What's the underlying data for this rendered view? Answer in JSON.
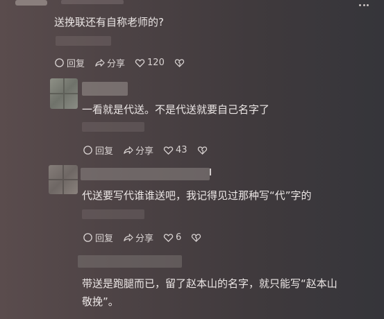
{
  "comments": [
    {
      "text": "送挽联还有自称老师的?",
      "reply_label": "回复",
      "share_label": "分享",
      "likes": "120"
    },
    {
      "text": "一看就是代送。不是代送就要自己名字了",
      "reply_label": "回复",
      "share_label": "分享",
      "likes": "43"
    },
    {
      "text": "代送要写代谁谁送吧，我记得见过那种写“代”字的",
      "reply_label": "回复",
      "share_label": "分享",
      "likes": "6"
    },
    {
      "text_line1": "带送是跑腿而已，留了赵本山的名字，就只能写“赵本山",
      "text_line2": "敬挽”。"
    }
  ]
}
